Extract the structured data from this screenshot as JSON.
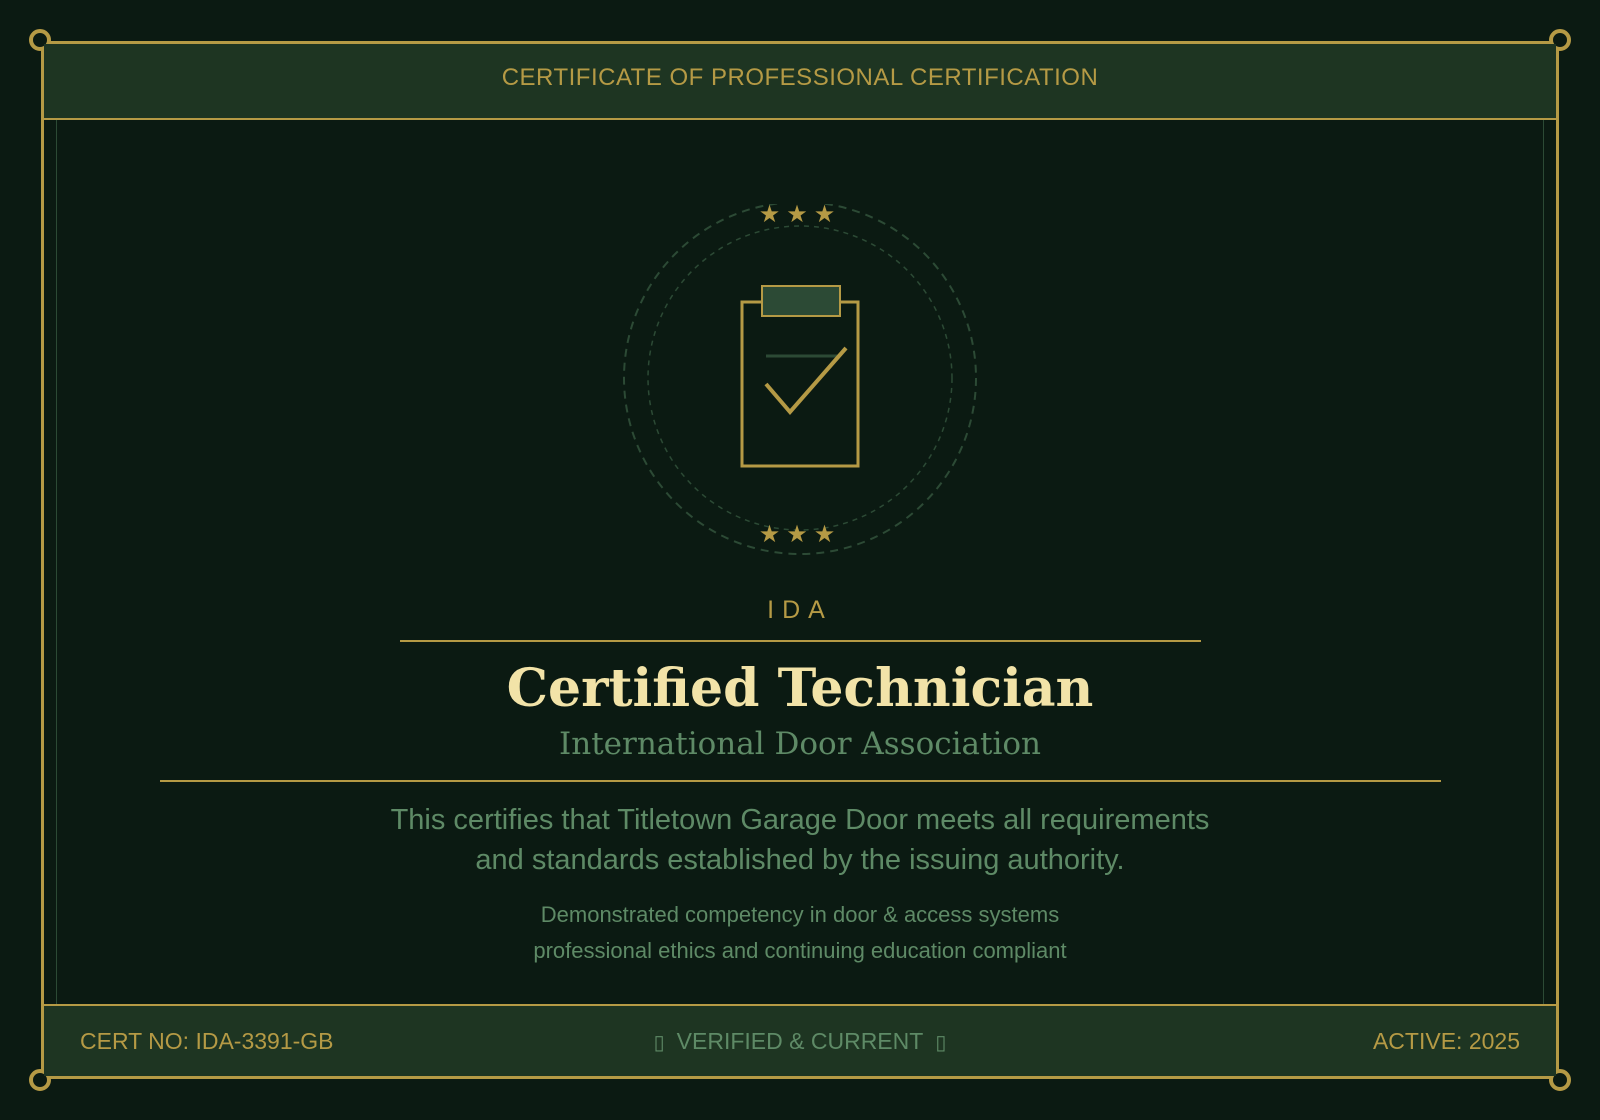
{
  "header": {
    "title": "CERTIFICATE OF PROFESSIONAL CERTIFICATION"
  },
  "seal": {
    "icon": "clipboard-check-icon",
    "stars": "★★★"
  },
  "issuer": {
    "abbreviation": "IDA",
    "name": "International Door Association"
  },
  "certificate": {
    "title": "Certified Technician",
    "statement_line1": "This certifies that Titletown Garage Door meets all requirements",
    "statement_line2": "and standards established by the issuing authority.",
    "detail_line1": "Demonstrated competency in door & access systems",
    "detail_line2": "professional ethics and continuing education compliant"
  },
  "footer": {
    "cert_no": "CERT NO: IDA-3391-GB",
    "status": "VERIFIED & CURRENT",
    "active": "ACTIVE: 2025"
  },
  "colors": {
    "background": "#0b1a12",
    "gold": "#b59a45",
    "title": "#f2e3a8",
    "muted_green": "#5e8a66",
    "band": "#1e3522"
  }
}
